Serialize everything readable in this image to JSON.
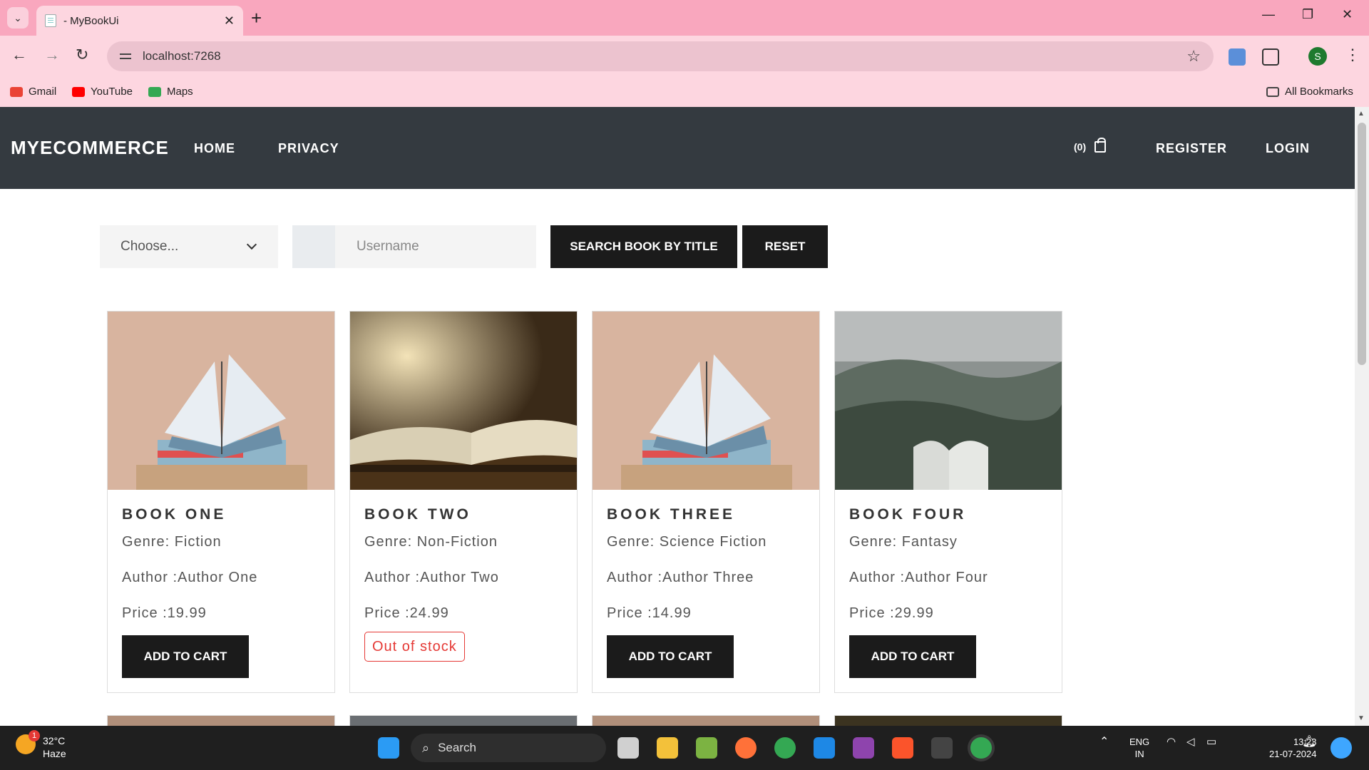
{
  "browser": {
    "tab_title": "- MyBookUi",
    "url": "localhost:7268",
    "bookmarks": [
      "Gmail",
      "YouTube",
      "Maps"
    ],
    "all_bookmarks": "All Bookmarks",
    "profile_initial": "S"
  },
  "navbar": {
    "brand": "MYECOMMERCE",
    "links": [
      "HOME",
      "PRIVACY"
    ],
    "cart_count": "(0)",
    "register": "REGISTER",
    "login": "LOGIN"
  },
  "search": {
    "genre_select": "Choose...",
    "title_placeholder": "Username",
    "search_button": "SEARCH BOOK BY TITLE",
    "reset_button": "RESET"
  },
  "books": [
    {
      "title": "BOOK ONE",
      "genre": "Genre: Fiction",
      "author": "Author :Author One",
      "price": "Price :19.99",
      "action": "ADD TO CART",
      "in_stock": true
    },
    {
      "title": "BOOK TWO",
      "genre": "Genre: Non-Fiction",
      "author": "Author :Author Two",
      "price": "Price :24.99",
      "action": "Out of stock",
      "in_stock": false
    },
    {
      "title": "BOOK THREE",
      "genre": "Genre: Science Fiction",
      "author": "Author :Author Three",
      "price": "Price :14.99",
      "action": "ADD TO CART",
      "in_stock": true
    },
    {
      "title": "BOOK FOUR",
      "genre": "Genre: Fantasy",
      "author": "Author :Author Four",
      "price": "Price :29.99",
      "action": "ADD TO CART",
      "in_stock": true
    }
  ],
  "taskbar": {
    "weather_temp": "32°C",
    "weather_desc": "Haze",
    "weather_badge": "1",
    "search_label": "Search",
    "language": "ENG",
    "region": "IN",
    "time": "13:23",
    "date": "21-07-2024"
  },
  "colors": {
    "tabbar": "#f9a7be",
    "toolbar": "#fdd6e0",
    "navbar": "#343a40",
    "button": "#1b1b1b",
    "out_of_stock": "#e53935"
  }
}
